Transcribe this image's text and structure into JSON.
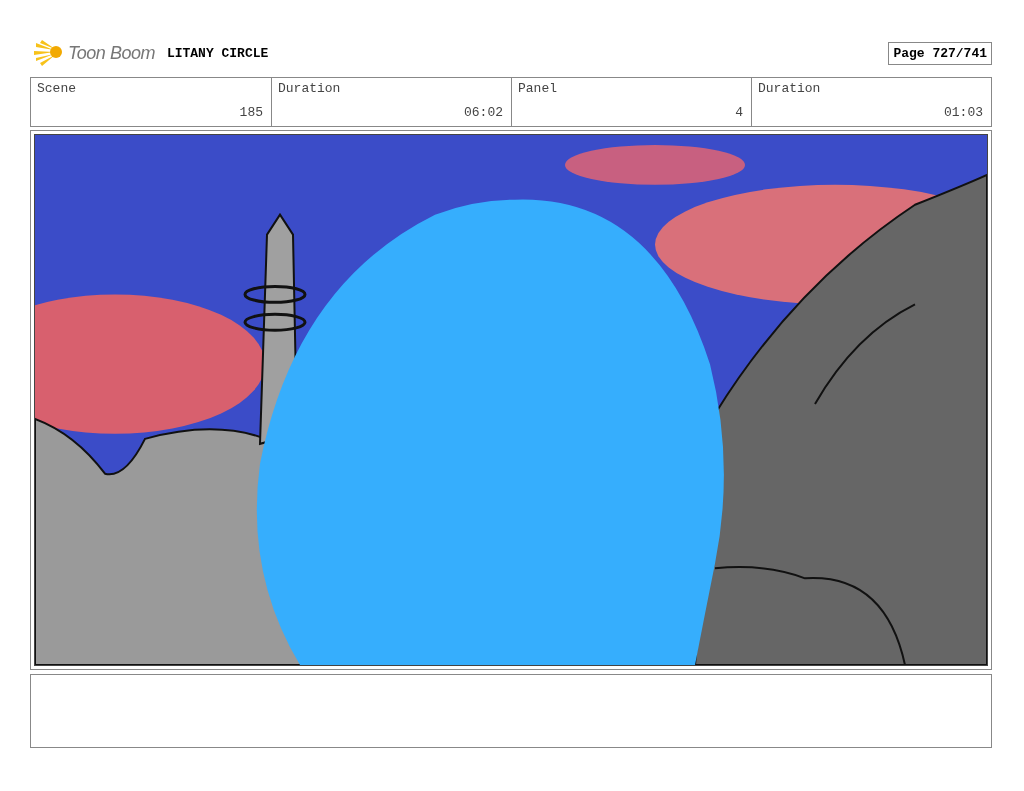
{
  "header": {
    "logo": "Toon Boom",
    "title": "LITANY CIRCLE",
    "page": "Page 727/741"
  },
  "fields": [
    {
      "label": "Scene",
      "value": "185"
    },
    {
      "label": "Duration",
      "value": "06:02"
    },
    {
      "label": "Panel",
      "value": "4"
    },
    {
      "label": "Duration",
      "value": "01:03"
    }
  ]
}
